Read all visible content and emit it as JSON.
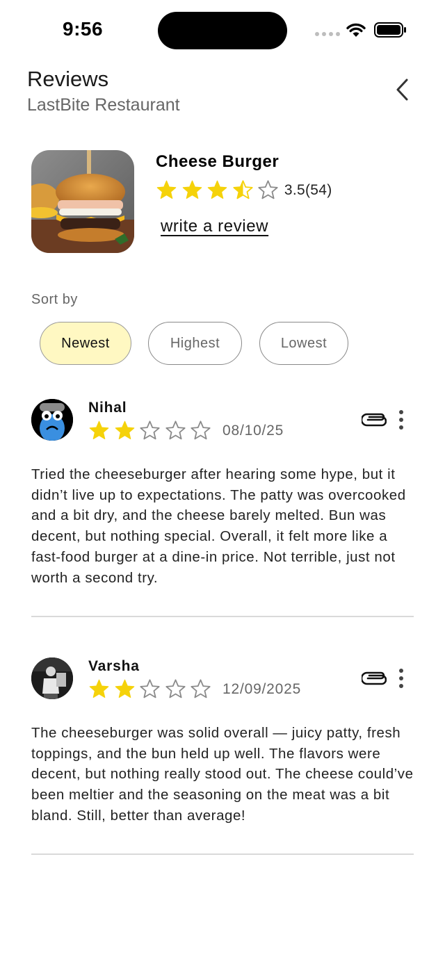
{
  "status_bar": {
    "time": "9:56"
  },
  "header": {
    "title": "Reviews",
    "subtitle": "LastBite Restaurant",
    "back_icon": "chevron-left-icon"
  },
  "product": {
    "name": "Cheese Burger",
    "rating_value": 3.5,
    "rating_text": "3.5(54)",
    "write_review_label": "write a review",
    "image": "cheeseburger-photo"
  },
  "sort": {
    "label": "Sort by",
    "options": [
      "Newest",
      "Highest",
      "Lowest"
    ],
    "selected": "Newest"
  },
  "reviews": [
    {
      "name": "Nihal",
      "rating": 2,
      "date": "08/10/25",
      "text": "Tried the cheeseburger after hearing some hype, but it didn’t live up to expectations. The patty was overcooked and a bit dry, and the cheese barely melted. Bun was decent, but nothing special. Overall, it felt more like a fast-food burger at a dine-in price. Not terrible, just not worth a second try.",
      "avatar": "blue-cartoon-avatar"
    },
    {
      "name": "Varsha",
      "rating": 2,
      "date": "12/09/2025",
      "text": "The cheeseburger was solid overall — juicy patty, fresh toppings, and the bun held up well. The flavors were decent, but nothing really stood out. The cheese could’ve been meltier and the seasoning on the meat was a bit bland. Still, better than average!",
      "avatar": "photo-avatar"
    }
  ],
  "colors": {
    "star_filled": "#f5d20a",
    "star_empty": "#8a8a8a",
    "chip_active_bg": "#fff8c2",
    "divider": "#d9d9d9"
  }
}
